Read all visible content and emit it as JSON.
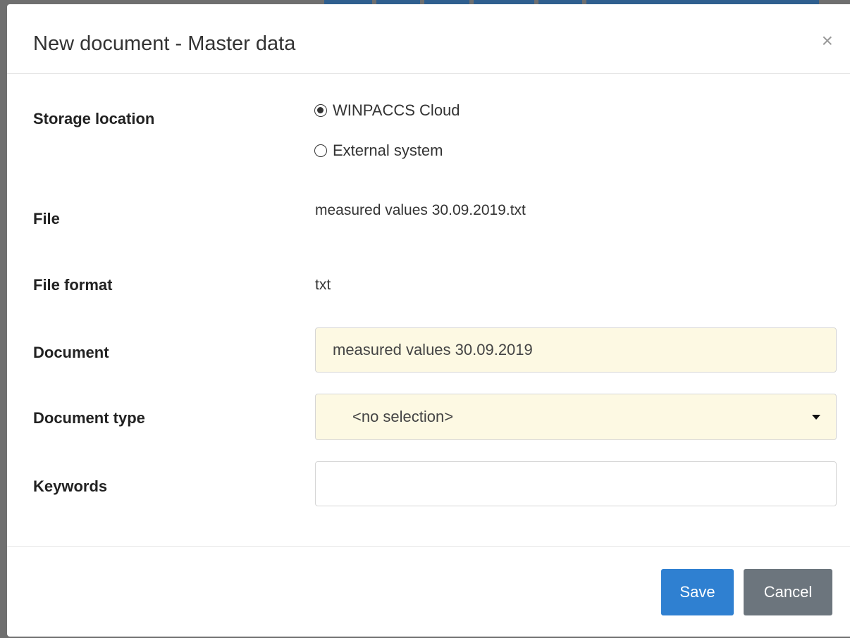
{
  "dialog": {
    "title": "New document - Master data",
    "close_label": "×"
  },
  "form": {
    "storage_location": {
      "label": "Storage location",
      "options": [
        {
          "label": "WINPACCS Cloud",
          "selected": true
        },
        {
          "label": "External system",
          "selected": false
        }
      ]
    },
    "file": {
      "label": "File",
      "value": "measured values 30.09.2019.txt"
    },
    "file_format": {
      "label": "File format",
      "value": "txt"
    },
    "document": {
      "label": "Document",
      "value": "measured values 30.09.2019"
    },
    "document_type": {
      "label": "Document type",
      "value": "<no selection>"
    },
    "keywords": {
      "label": "Keywords",
      "value": ""
    }
  },
  "footer": {
    "save_label": "Save",
    "cancel_label": "Cancel"
  },
  "colors": {
    "primary": "#2f80d1",
    "secondary": "#6c757d",
    "required_field_bg": "#fdf9e3"
  }
}
